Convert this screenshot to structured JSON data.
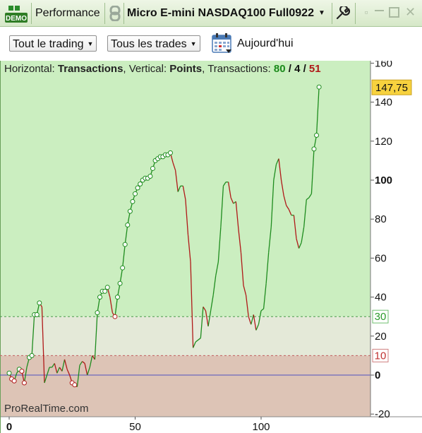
{
  "titlebar": {
    "badge": "DEMO",
    "panel_title": "Performance",
    "instrument": "Micro E-mini NASDAQ100 Full0922",
    "icons": [
      "demo-icon",
      "link-icon",
      "chevron-down-icon",
      "wrench-icon",
      "minimize-icon",
      "maximize-icon",
      "close-icon"
    ]
  },
  "toolbar": {
    "filter_trading": "Tout le trading",
    "filter_trades": "Tous les trades",
    "date_label": "Aujourd'hui"
  },
  "chart_info": {
    "h_prefix": "Horizontal:",
    "h_value": "Transactions",
    "v_prefix": ", Vertical:",
    "v_value": "Points",
    "t_prefix": ", Transactions:",
    "wins": "80",
    "slash1": "/",
    "neutral": "4",
    "slash2": "/",
    "losses": "51"
  },
  "watermark": "ProRealTime.com",
  "colors": {
    "up": "#1e8c1e",
    "down": "#b01818",
    "zone_high": "#cbeec0",
    "zone_mid": "#e4e9d8",
    "zone_low": "#ddc4b6",
    "zero_line": "#5050c0",
    "last_value_bg": "#f7d23e"
  },
  "chart_data": {
    "type": "line",
    "xlabel": "",
    "ylabel": "",
    "xlim": [
      0,
      142
    ],
    "ylim": [
      -22,
      163
    ],
    "x_ticks": [
      0,
      50,
      100
    ],
    "y_ticks": [
      -20,
      0,
      20,
      40,
      60,
      80,
      100,
      120,
      140,
      160
    ],
    "y_bold_ticks": [
      0,
      100
    ],
    "levels": [
      {
        "name": "upper",
        "value": 30
      },
      {
        "name": "lower",
        "value": 10
      }
    ],
    "last_value": 147.75,
    "last_value_label": "147,75",
    "series": [
      {
        "values": [
          1,
          -2,
          -3,
          1,
          3,
          2,
          -4,
          4,
          9,
          10,
          31,
          31,
          37,
          35,
          -4,
          0,
          4,
          4,
          6,
          1,
          4,
          2,
          8,
          3,
          0,
          -4,
          -5,
          -6,
          5,
          7,
          6,
          0,
          4,
          10,
          8,
          32,
          40,
          43,
          43,
          45,
          40,
          32,
          30,
          40,
          47,
          55,
          67,
          77,
          84,
          89,
          93,
          96,
          98,
          100,
          101,
          101,
          102,
          106,
          110,
          111,
          112,
          112,
          113,
          113,
          114,
          109,
          105,
          94,
          97,
          97,
          90,
          72,
          58,
          14,
          17,
          18,
          19,
          35,
          33,
          25,
          33,
          41,
          51,
          58,
          76,
          97,
          99,
          99,
          91,
          88,
          89,
          75,
          63,
          46,
          41,
          30,
          26,
          31,
          23,
          26,
          33,
          34,
          47,
          63,
          76,
          100,
          108,
          111,
          100,
          92,
          87,
          85,
          82,
          82,
          70,
          65,
          68,
          76,
          90,
          91,
          93,
          116,
          123,
          147.75
        ],
        "markers": [
          0,
          1,
          2,
          4,
          5,
          6,
          8,
          9,
          10,
          11,
          12,
          25,
          26,
          35,
          36,
          37,
          38,
          39,
          42,
          43,
          44,
          45,
          46,
          47,
          48,
          49,
          50,
          51,
          52,
          53,
          54,
          55,
          56,
          57,
          58,
          59,
          60,
          61,
          62,
          63,
          64,
          121,
          122,
          123
        ]
      }
    ]
  }
}
